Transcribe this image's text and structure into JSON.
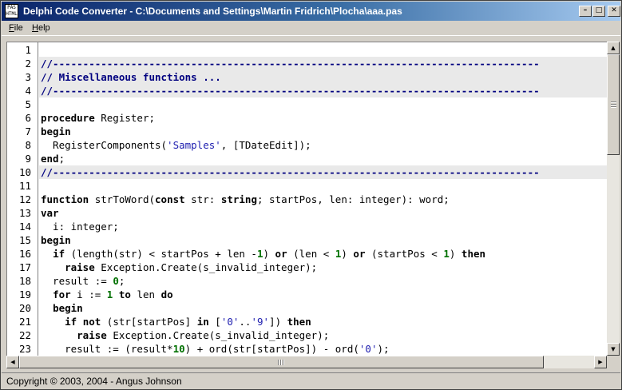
{
  "window": {
    "title": "Delphi Code Converter - C:\\Documents and Settings\\Martin Fridrich\\Plocha\\aaa.pas",
    "icon_text_top": "PAS",
    "icon_text_bottom": "HTML",
    "minimize_glyph": "–",
    "maximize_glyph": "□",
    "close_glyph": "✕"
  },
  "menu": {
    "file": {
      "accel": "F",
      "rest": "ile"
    },
    "help": {
      "accel": "H",
      "rest": "elp"
    }
  },
  "status": {
    "text": "Copyright © 2003, 2004 - Angus Johnson"
  },
  "scrollbars": {
    "up_glyph": "▲",
    "down_glyph": "▼",
    "left_glyph": "◀",
    "right_glyph": "▶"
  },
  "colors": {
    "titlebar_start": "#0a246a",
    "titlebar_end": "#a6caf0",
    "comment": "#000080",
    "string": "#2020b0",
    "number": "#007000",
    "band": "#e9e9e9"
  },
  "code_lines": [
    {
      "n": "1",
      "band": false,
      "tokens": []
    },
    {
      "n": "2",
      "band": true,
      "tokens": [
        [
          "cmt",
          "//---------------------------------------------------------------------------------"
        ]
      ]
    },
    {
      "n": "3",
      "band": true,
      "tokens": [
        [
          "cmt",
          "// Miscellaneous functions ..."
        ]
      ]
    },
    {
      "n": "4",
      "band": true,
      "tokens": [
        [
          "cmt",
          "//---------------------------------------------------------------------------------"
        ]
      ]
    },
    {
      "n": "5",
      "band": false,
      "tokens": []
    },
    {
      "n": "6",
      "band": false,
      "tokens": [
        [
          "kw",
          "procedure"
        ],
        [
          "t",
          " Register;"
        ]
      ]
    },
    {
      "n": "7",
      "band": false,
      "tokens": [
        [
          "kw",
          "begin"
        ]
      ]
    },
    {
      "n": "8",
      "band": false,
      "tokens": [
        [
          "t",
          "  RegisterComponents("
        ],
        [
          "str",
          "'Samples'"
        ],
        [
          "t",
          ", [TDateEdit]);"
        ]
      ]
    },
    {
      "n": "9",
      "band": false,
      "tokens": [
        [
          "kw",
          "end"
        ],
        [
          "t",
          ";"
        ]
      ]
    },
    {
      "n": "10",
      "band": true,
      "tokens": [
        [
          "cmt",
          "//---------------------------------------------------------------------------------"
        ]
      ]
    },
    {
      "n": "11",
      "band": false,
      "tokens": []
    },
    {
      "n": "12",
      "band": false,
      "tokens": [
        [
          "kw",
          "function"
        ],
        [
          "t",
          " strToWord("
        ],
        [
          "kw",
          "const"
        ],
        [
          "t",
          " str: "
        ],
        [
          "kw",
          "string"
        ],
        [
          "t",
          "; startPos, len: integer): word;"
        ]
      ]
    },
    {
      "n": "13",
      "band": false,
      "tokens": [
        [
          "kw",
          "var"
        ]
      ]
    },
    {
      "n": "14",
      "band": false,
      "tokens": [
        [
          "t",
          "  i: integer;"
        ]
      ]
    },
    {
      "n": "15",
      "band": false,
      "tokens": [
        [
          "kw",
          "begin"
        ]
      ]
    },
    {
      "n": "16",
      "band": false,
      "tokens": [
        [
          "t",
          "  "
        ],
        [
          "kw",
          "if"
        ],
        [
          "t",
          " (length(str) < startPos + len -"
        ],
        [
          "num",
          "1"
        ],
        [
          "t",
          ") "
        ],
        [
          "kw",
          "or"
        ],
        [
          "t",
          " (len < "
        ],
        [
          "num",
          "1"
        ],
        [
          "t",
          ") "
        ],
        [
          "kw",
          "or"
        ],
        [
          "t",
          " (startPos < "
        ],
        [
          "num",
          "1"
        ],
        [
          "t",
          ") "
        ],
        [
          "kw",
          "then"
        ]
      ]
    },
    {
      "n": "17",
      "band": false,
      "tokens": [
        [
          "t",
          "    "
        ],
        [
          "kw",
          "raise"
        ],
        [
          "t",
          " Exception.Create(s_invalid_integer);"
        ]
      ]
    },
    {
      "n": "18",
      "band": false,
      "tokens": [
        [
          "t",
          "  result := "
        ],
        [
          "num",
          "0"
        ],
        [
          "t",
          ";"
        ]
      ]
    },
    {
      "n": "19",
      "band": false,
      "tokens": [
        [
          "t",
          "  "
        ],
        [
          "kw",
          "for"
        ],
        [
          "t",
          " i := "
        ],
        [
          "num",
          "1"
        ],
        [
          "t",
          " "
        ],
        [
          "kw",
          "to"
        ],
        [
          "t",
          " len "
        ],
        [
          "kw",
          "do"
        ]
      ]
    },
    {
      "n": "20",
      "band": false,
      "tokens": [
        [
          "t",
          "  "
        ],
        [
          "kw",
          "begin"
        ]
      ]
    },
    {
      "n": "21",
      "band": false,
      "tokens": [
        [
          "t",
          "    "
        ],
        [
          "kw",
          "if"
        ],
        [
          "t",
          " "
        ],
        [
          "kw",
          "not"
        ],
        [
          "t",
          " (str[startPos] "
        ],
        [
          "kw",
          "in"
        ],
        [
          "t",
          " ["
        ],
        [
          "str",
          "'0'"
        ],
        [
          "t",
          ".."
        ],
        [
          "str",
          "'9'"
        ],
        [
          "t",
          "]) "
        ],
        [
          "kw",
          "then"
        ]
      ]
    },
    {
      "n": "22",
      "band": false,
      "tokens": [
        [
          "t",
          "      "
        ],
        [
          "kw",
          "raise"
        ],
        [
          "t",
          " Exception.Create(s_invalid_integer);"
        ]
      ]
    },
    {
      "n": "23",
      "band": false,
      "tokens": [
        [
          "t",
          "    result := (result*"
        ],
        [
          "num",
          "10"
        ],
        [
          "t",
          ") + ord(str[startPos]) - ord("
        ],
        [
          "str",
          "'0'"
        ],
        [
          "t",
          ");"
        ]
      ]
    }
  ]
}
